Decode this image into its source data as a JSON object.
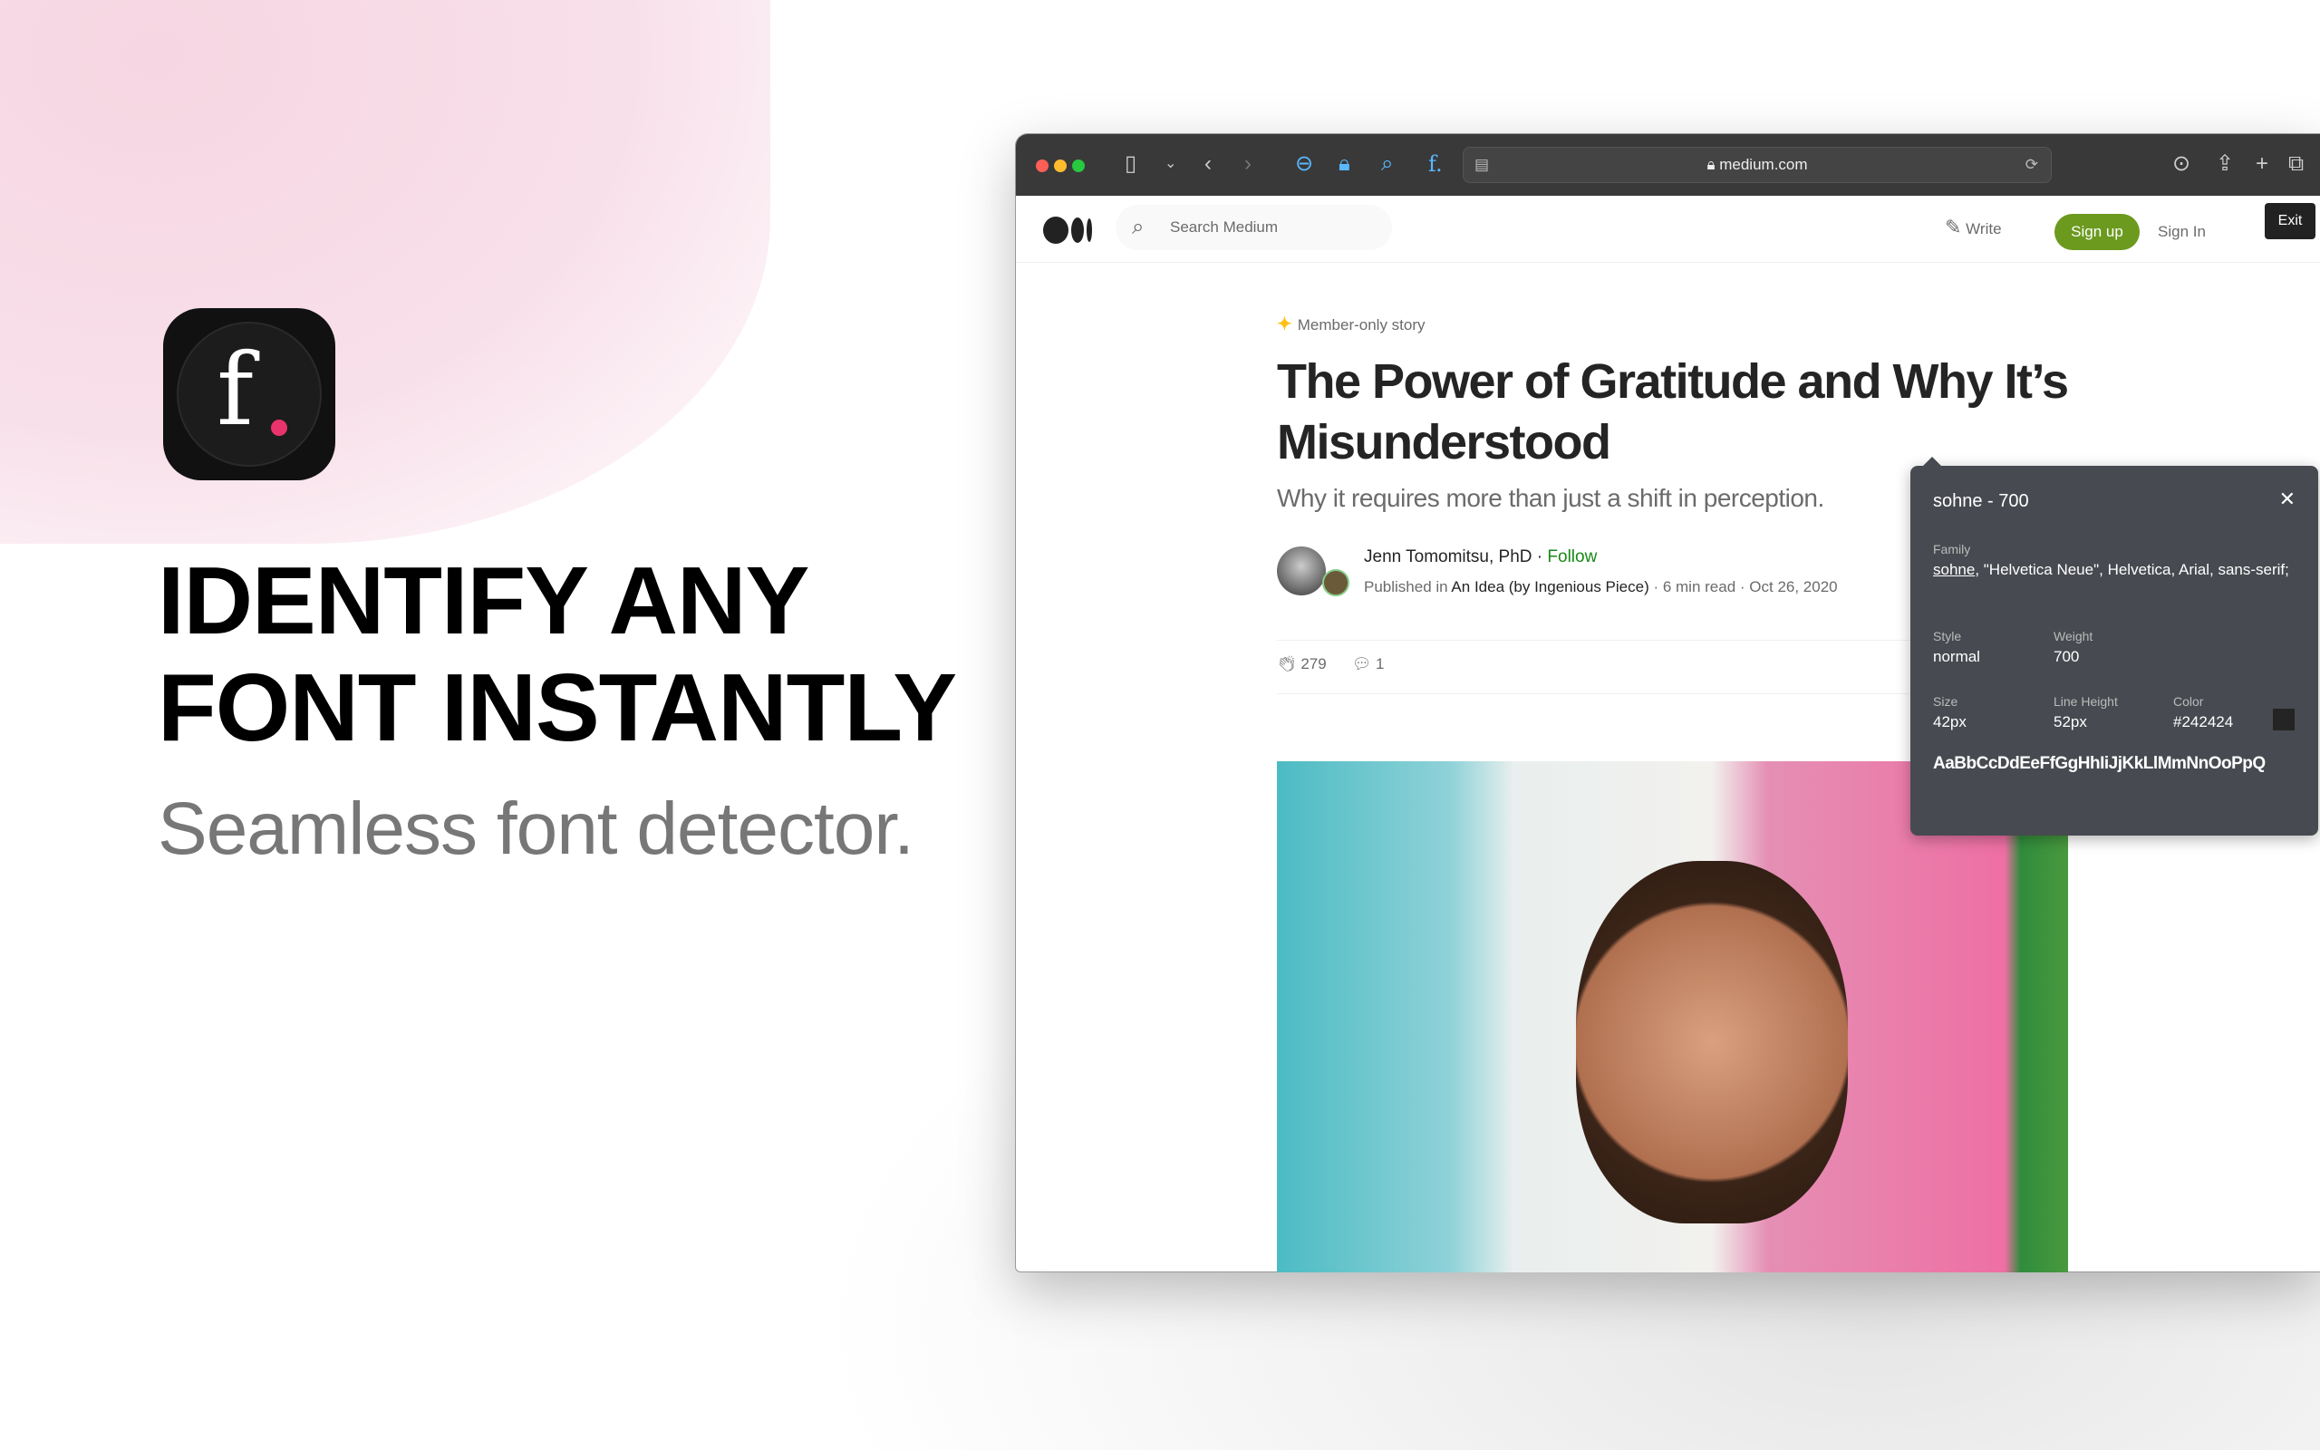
{
  "promo": {
    "headline_line1": "IDENTIFY ANY",
    "headline_line2": "FONT INSTANTLY",
    "subtitle": "Seamless font detector.",
    "icon_letter": "f",
    "accent": "#e8336d"
  },
  "browser": {
    "url": "medium.com"
  },
  "medium": {
    "search_placeholder": "Search Medium",
    "write": "Write",
    "sign_up": "Sign up",
    "sign_in": "Sign In",
    "exit": "Exit",
    "member_label": "Member-only story",
    "title": "The Power of Gratitude and Why It’s Misunderstood",
    "subtitle": "Why it requires more than just a shift in perception.",
    "author": "Jenn Tomomitsu, PhD",
    "follow": "Follow",
    "published_in_label": "Published in",
    "publication": "An Idea (by Ingenious Piece)",
    "read_time": "6 min read",
    "date": "Oct 26, 2020",
    "claps": "279",
    "comments": "1",
    "brand_green": "#6b9a1f"
  },
  "font_popup": {
    "heading": "sohne - 700",
    "family_label": "Family",
    "family_first": "sohne",
    "family_rest": ", \"Helvetica Neue\", Helvetica, Arial, sans-serif;",
    "style_label": "Style",
    "style": "normal",
    "weight_label": "Weight",
    "weight": "700",
    "size_label": "Size",
    "size": "42px",
    "line_height_label": "Line Height",
    "line_height": "52px",
    "color_label": "Color",
    "color": "#242424",
    "sample": "AaBbCcDdEeFfGgHhIiJjKkLlMmNnOoPpQ"
  }
}
